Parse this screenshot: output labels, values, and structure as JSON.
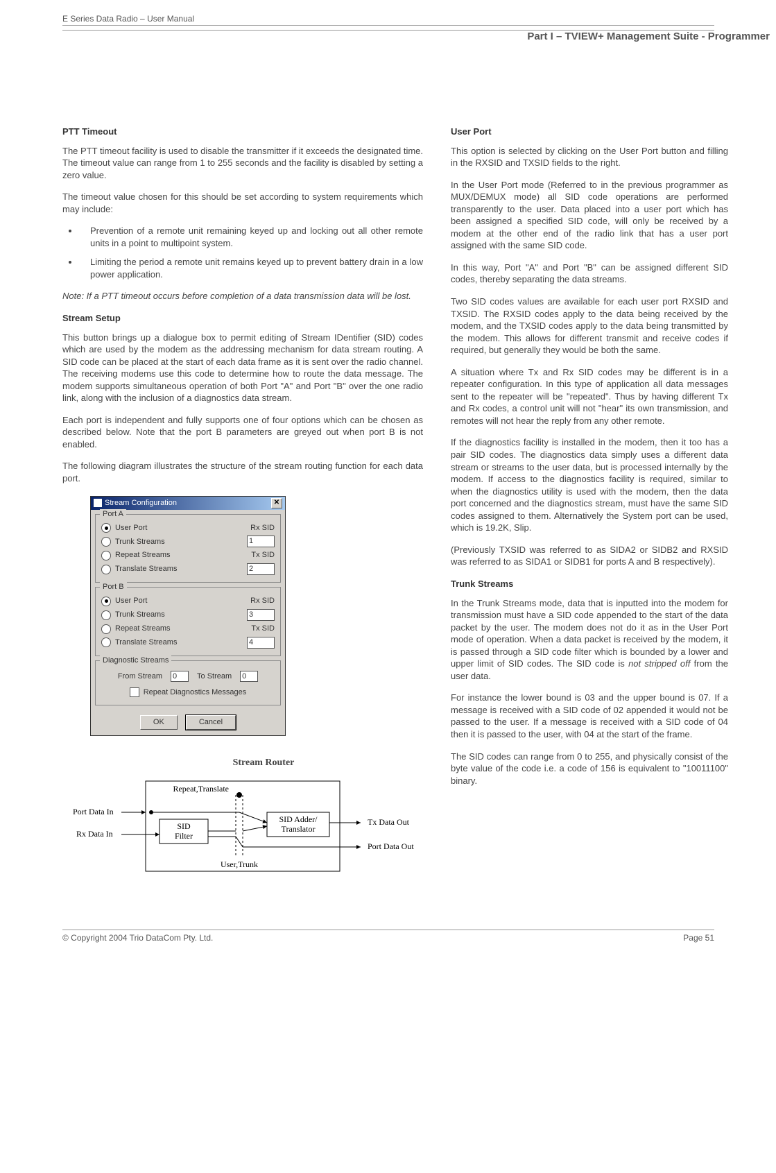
{
  "header": {
    "manual_title": "E Series Data Radio – User Manual",
    "section_title": "Part I – TVIEW+ Management Suite - Programmer"
  },
  "left_column": {
    "h_ptt": "PTT  Timeout",
    "p1": "The PTT timeout facility is used to disable the transmitter if it exceeds the designated time. The timeout value can range from 1 to 255 seconds and the facility is disabled by setting a zero value.",
    "p2": "The timeout value chosen for this should be set according to system requirements which may include:",
    "bullets": [
      "Prevention of a remote unit remaining keyed up and locking out all other remote units in a point to multipoint system.",
      "Limiting the period a remote unit remains keyed up to prevent battery drain in a low power application."
    ],
    "note": "Note: If a PTT timeout occurs before completion of a data transmission data will be lost.",
    "h_stream": "Stream Setup",
    "p3": "This button brings up a dialogue box to permit editing of Stream IDentifier (SID) codes which are used by the modem as the addressing mechanism for data stream routing. A SID code can be placed at the start of each data frame as it is sent over the radio channel.  The receiving modems use this code to determine how to route the data message. The modem supports simultaneous operation of both Port \"A\" and Port \"B\" over the one radio link, along with the inclusion of a diagnostics data stream.",
    "p4": "Each port is independent and fully supports one of four options which can be chosen as described below. Note that the port B parameters are greyed out when port B is not enabled.",
    "p5": "The following diagram illustrates the structure of the stream routing function for each data port."
  },
  "right_column": {
    "h_user": "User Port",
    "p1": "This option is selected by clicking on the User Port button and filling in the RXSID and TXSID fields to the right.",
    "p2": "In the User Port mode (Referred to in the previous programmer as MUX/DEMUX mode) all SID code operations are performed transparently to the user.  Data placed into a user port which has been assigned a specified SID code, will only be received by a modem at the other end of the radio link that has a user port assigned with the same SID code.",
    "p3": "In this way, Port \"A\" and Port \"B\" can be assigned different SID codes, thereby separating the data streams.",
    "p4": "Two SID codes values are available for each user port RXSID and TXSID.  The RXSID codes apply to the data being received by the modem, and the TXSID codes apply to the data being transmitted by the modem.  This allows for different transmit and receive codes if required, but generally they would be both the same.",
    "p5": "A situation where Tx and Rx SID codes may be different is in a repeater configuration.  In this type of application all data messages sent to the repeater will be \"repeated\".  Thus by having different Tx and Rx codes, a control unit will not \"hear\" its own transmission, and remotes will not hear the reply from any other remote.",
    "p6": "If the diagnostics facility is installed in the modem, then it too has a pair SID codes.  The diagnostics data simply uses a different data stream or streams to the user data, but is processed internally by the modem. If access to the diagnostics facility is required, similar to when the diagnostics utility is used with the modem, then the data port concerned and the diagnostics stream, must have the same SID codes assigned to them. Alternatively the System port can be used, which is 19.2K, Slip.",
    "p7": "(Previously TXSID was referred to as SIDA2 or SIDB2 and RXSID was referred to as SIDA1 or SIDB1 for ports A and B respectively).",
    "h_trunk": "Trunk Streams",
    "p8": "In the Trunk Streams mode, data that is inputted into the modem for transmission must have a SID code appended to the start of the data packet by the user.  The modem does not do it as in the User Port mode of operation.  When a data packet is received by the modem, it is passed through a SID code filter which is bounded by a lower and upper limit of SID codes.  The SID code is ",
    "p8_em": "not stripped off",
    "p8_tail": " from the user data.",
    "p9": "For instance the lower bound is 03 and the upper bound is 07.  If a message is received with a SID code of 02 appended it would not be passed to the user.  If a message is received with a SID code of 04 then it is passed to the user, with 04 at the start of the frame.",
    "p10": "The SID codes can range from 0 to 255, and physically consist of the byte value of the code i.e. a code of 156 is equivalent to \"10011100\" binary."
  },
  "dialog": {
    "title": "Stream Configuration",
    "portA": {
      "legend": "Port A",
      "options": [
        "User Port",
        "Trunk Streams",
        "Repeat Streams",
        "Translate Streams"
      ],
      "selected": 0,
      "rx_label": "Rx SID",
      "rx_value": "1",
      "tx_label": "Tx SID",
      "tx_value": "2"
    },
    "portB": {
      "legend": "Port B",
      "options": [
        "User Port",
        "Trunk Streams",
        "Repeat Streams",
        "Translate Streams"
      ],
      "selected": 0,
      "rx_label": "Rx SID",
      "rx_value": "3",
      "tx_label": "Tx SID",
      "tx_value": "4"
    },
    "diag": {
      "legend": "Diagnostic Streams",
      "from_label": "From Stream",
      "from_value": "0",
      "to_label": "To Stream",
      "to_value": "0",
      "chk_label": "Repeat Diagnostics Messages"
    },
    "buttons": {
      "ok": "OK",
      "cancel": "Cancel"
    }
  },
  "router": {
    "title": "Stream Router",
    "repeat_translate": "Repeat,Translate",
    "port_data_in": "Port Data In",
    "rx_data_in": "Rx Data In",
    "sid_filter": "SID\nFilter",
    "sid_adder": "SID Adder/\nTranslator",
    "user_trunk": "User,Trunk",
    "tx_data_out": "Tx Data Out",
    "port_data_out": "Port Data Out"
  },
  "footer": {
    "copyright": "© Copyright 2004 Trio DataCom Pty. Ltd.",
    "page": "Page 51"
  }
}
